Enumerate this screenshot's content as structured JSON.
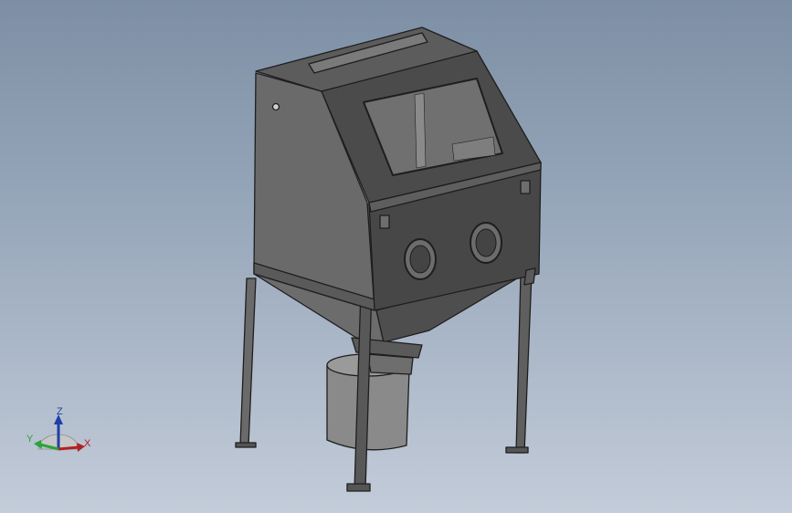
{
  "viewport": {
    "background_top": "#7d8fa5",
    "background_bottom": "#c3ccd9"
  },
  "model": {
    "description_icon": "sandblast-cabinet-model",
    "body_color": "#5b5b5b",
    "edge_color": "#1e1e1e"
  },
  "triad": {
    "z_label": "Z",
    "y_label": "Y",
    "x_label": "X",
    "z_color": "#1f3fa8",
    "y_color": "#2aa33a",
    "x_color": "#b32020"
  }
}
